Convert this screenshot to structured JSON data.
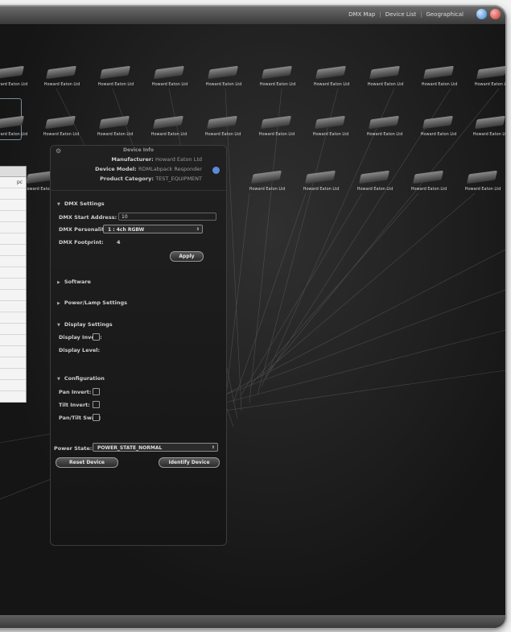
{
  "nav": {
    "links": [
      "DMX Map",
      "Device List",
      "Geographical"
    ]
  },
  "device_label": "Howard Eaton Ltd",
  "left_panel": {
    "fragment": "pc"
  },
  "device_info": {
    "title": "Device Info",
    "manufacturer_label": "Manufacturer:",
    "manufacturer_value": "Howard Eaton Ltd",
    "model_label": "Device Model:",
    "model_value": "RDMLabpack Responder",
    "category_label": "Product Category:",
    "category_value": "TEST_EQUIPMENT",
    "dmx_settings": {
      "heading": "DMX Settings",
      "start_address_label": "DMX Start Address:",
      "start_address_value": "10",
      "personality_label": "DMX Personality:",
      "personality_value": "1 : 4ch RGBW",
      "footprint_label": "DMX Footprint:",
      "footprint_value": "4",
      "apply_label": "Apply"
    },
    "software_heading": "Software",
    "power_lamp_heading": "Power/Lamp Settings",
    "display_settings": {
      "heading": "Display Settings",
      "invert_label": "Display Invert:",
      "level_label": "Display Level:"
    },
    "configuration": {
      "heading": "Configuration",
      "pan_invert_label": "Pan Invert:",
      "tilt_invert_label": "Tilt Invert:",
      "pan_tilt_swap_label": "Pan/Tilt Swap:"
    },
    "power_state_label": "Power State:",
    "power_state_value": "POWER_STATE_NORMAL",
    "reset_label": "Reset Device",
    "identify_label": "Identify Device"
  },
  "colors": {
    "accent_blue": "#5b8cd8",
    "panel_bg": "#1b1b1b",
    "canvas_bg": "#1f1f1f"
  }
}
